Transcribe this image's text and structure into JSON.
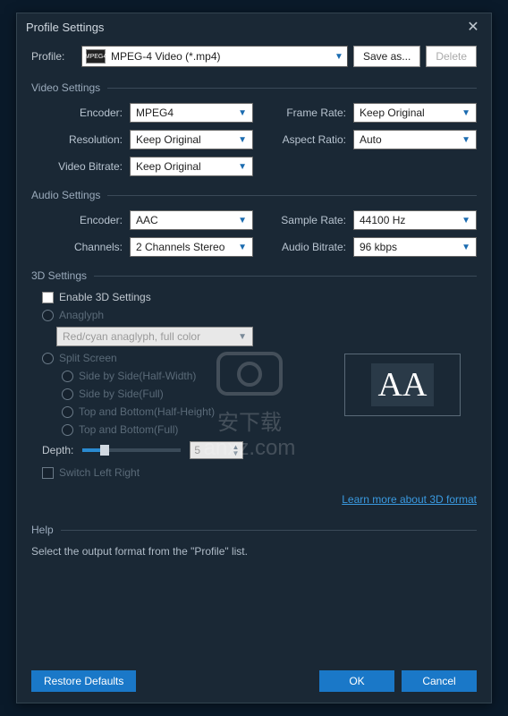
{
  "dialog": {
    "title": "Profile Settings",
    "profile_label": "Profile:",
    "profile_value": "MPEG-4 Video (*.mp4)",
    "profile_icon": "MPEG4",
    "save_as": "Save as...",
    "delete": "Delete"
  },
  "video": {
    "section": "Video Settings",
    "encoder_label": "Encoder:",
    "encoder": "MPEG4",
    "frame_rate_label": "Frame Rate:",
    "frame_rate": "Keep Original",
    "resolution_label": "Resolution:",
    "resolution": "Keep Original",
    "aspect_ratio_label": "Aspect Ratio:",
    "aspect_ratio": "Auto",
    "video_bitrate_label": "Video Bitrate:",
    "video_bitrate": "Keep Original"
  },
  "audio": {
    "section": "Audio Settings",
    "encoder_label": "Encoder:",
    "encoder": "AAC",
    "sample_rate_label": "Sample Rate:",
    "sample_rate": "44100 Hz",
    "channels_label": "Channels:",
    "channels": "2 Channels Stereo",
    "audio_bitrate_label": "Audio Bitrate:",
    "audio_bitrate": "96 kbps"
  },
  "threed": {
    "section": "3D Settings",
    "enable": "Enable 3D Settings",
    "anaglyph": "Anaglyph",
    "anaglyph_mode": "Red/cyan anaglyph, full color",
    "split_screen": "Split Screen",
    "sbs_half": "Side by Side(Half-Width)",
    "sbs_full": "Side by Side(Full)",
    "tab_half": "Top and Bottom(Half-Height)",
    "tab_full": "Top and Bottom(Full)",
    "depth_label": "Depth:",
    "depth_value": "5",
    "switch_lr": "Switch Left Right",
    "learn_more": "Learn more about 3D format",
    "preview": "AA"
  },
  "help": {
    "section": "Help",
    "text": "Select the output format from the \"Profile\" list."
  },
  "footer": {
    "restore": "Restore Defaults",
    "ok": "OK",
    "cancel": "Cancel"
  }
}
